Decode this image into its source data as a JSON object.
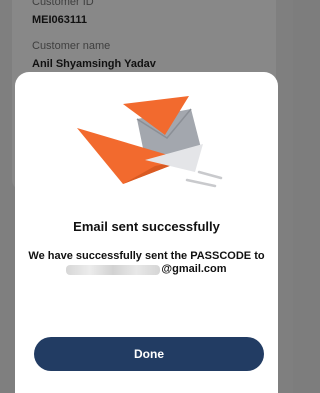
{
  "background": {
    "customer_id_label": "Customer ID",
    "customer_id_value": "MEI063111",
    "customer_name_label": "Customer name",
    "customer_name_value": "Anil Shyamsingh Yadav"
  },
  "modal": {
    "illustration_icon": "email-sent-envelope-icon",
    "title": "Email sent successfully",
    "message_line1": "We have successfully sent the PASSCODE to",
    "email_visible_suffix": "@gmail.com",
    "done_label": "Done"
  },
  "colors": {
    "accent_orange": "#f26a2e",
    "button_navy": "#223c63",
    "envelope_grey": "#a3a7ae"
  }
}
